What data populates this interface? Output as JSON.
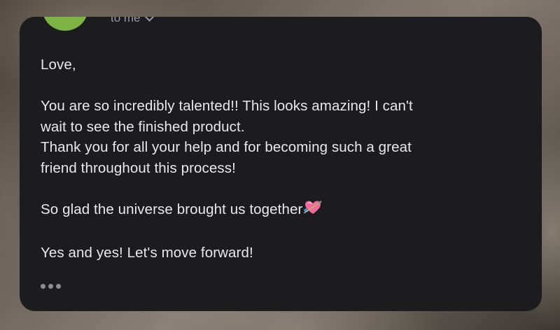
{
  "email": {
    "recipient_label": "to me",
    "greeting": "Love,",
    "line1": "You are so incredibly talented!! This looks amazing! I can't",
    "line2": "wait to see the finished product.",
    "line3": "Thank you for all your help and for becoming such a great",
    "line4": "friend throughout this process!",
    "line5": "So glad the universe brought us together",
    "line5_emoji": "heart-with-arrow-icon",
    "line6": "Yes and yes! Let's move forward!"
  },
  "colors": {
    "card_background": "#1c1c1f",
    "avatar": "#7cb342",
    "text": "#e9e9ec",
    "muted": "#9a9aa0"
  }
}
